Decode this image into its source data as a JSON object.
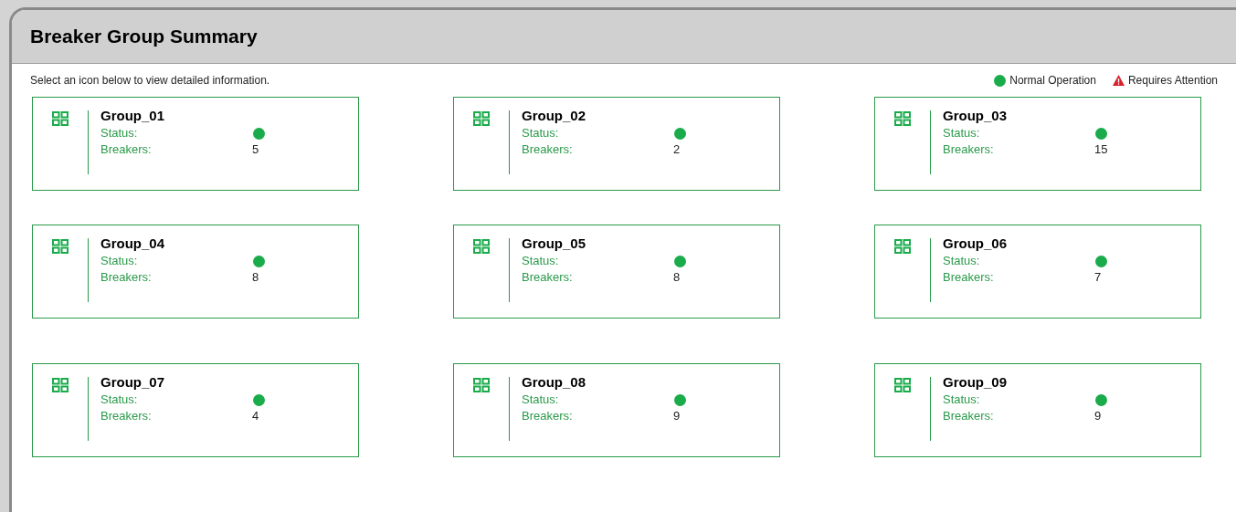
{
  "header": {
    "title": "Breaker Group Summary"
  },
  "instructions": "Select an icon below to view detailed information.",
  "legend": [
    {
      "kind": "normal",
      "label": "Normal Operation"
    },
    {
      "kind": "attention",
      "label": "Requires Attention"
    }
  ],
  "groups": [
    {
      "name": "Group_01",
      "status_label": "Status:",
      "attention": false,
      "breakers_label": "Breakers:",
      "breakers": "5"
    },
    {
      "name": "Group_02",
      "status_label": "Status:",
      "attention": false,
      "breakers_label": "Breakers:",
      "breakers": "2"
    },
    {
      "name": "Group_03",
      "status_label": "Status:",
      "attention": false,
      "breakers_label": "Breakers:",
      "breakers": "15"
    },
    {
      "name": "Group_04",
      "status_label": "Status:",
      "attention": false,
      "breakers_label": "Breakers:",
      "breakers": "8"
    },
    {
      "name": "Group_05",
      "status_label": "Status:",
      "attention": false,
      "breakers_label": "Breakers:",
      "breakers": "8"
    },
    {
      "name": "Group_06",
      "status_label": "Status:",
      "attention": false,
      "breakers_label": "Breakers:",
      "breakers": "7"
    },
    {
      "name": "Group_07",
      "status_label": "Status:",
      "attention": false,
      "breakers_label": "Breakers:",
      "breakers": "4"
    },
    {
      "name": "Group_08",
      "status_label": "Status:",
      "attention": false,
      "breakers_label": "Breakers:",
      "breakers": "9"
    },
    {
      "name": "Group_09",
      "status_label": "Status:",
      "attention": false,
      "breakers_label": "Breakers:",
      "breakers": "9"
    }
  ]
}
